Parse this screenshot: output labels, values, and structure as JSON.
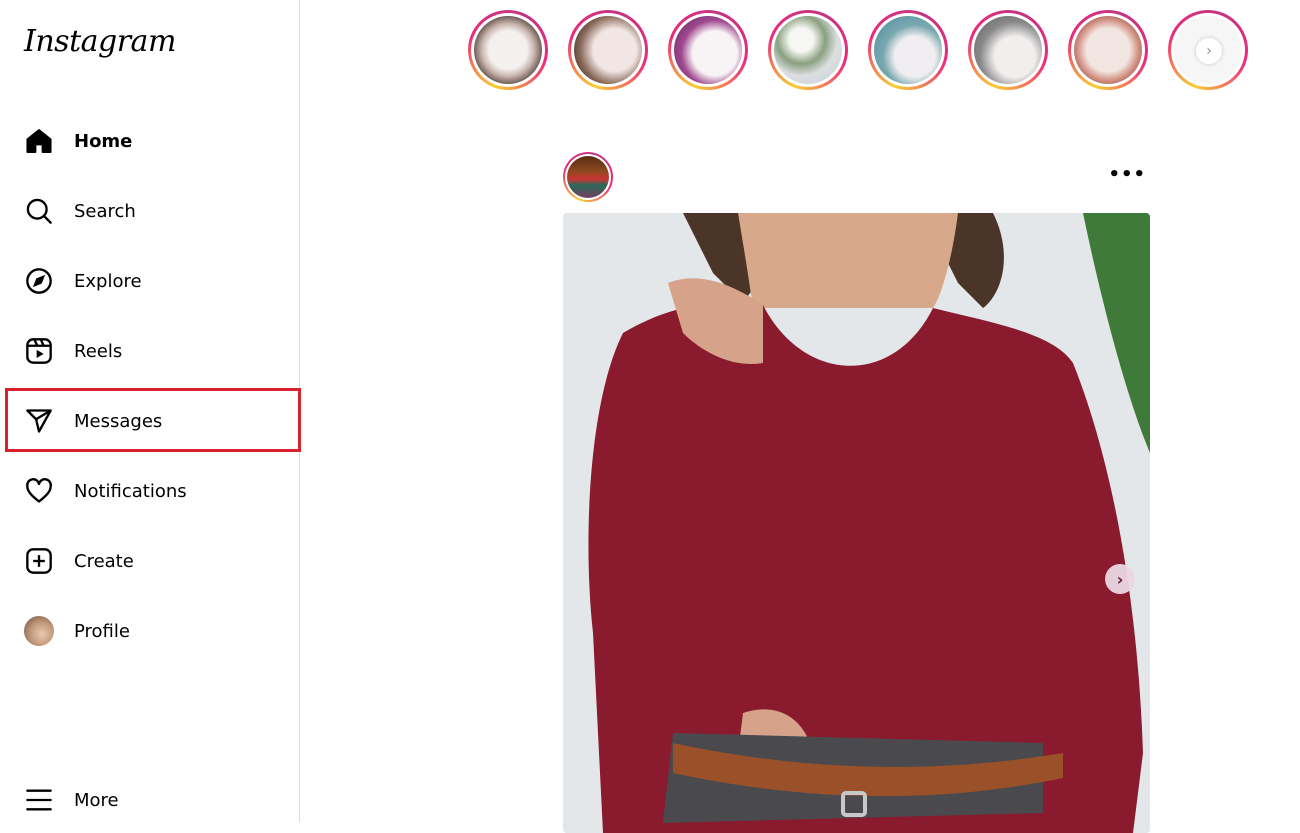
{
  "app": {
    "logo_text": "Instagram"
  },
  "sidebar": {
    "items": [
      {
        "label": "Home",
        "icon": "home-icon",
        "active": true
      },
      {
        "label": "Search",
        "icon": "search-icon"
      },
      {
        "label": "Explore",
        "icon": "compass-icon"
      },
      {
        "label": "Reels",
        "icon": "reels-icon"
      },
      {
        "label": "Messages",
        "icon": "paper-plane-icon",
        "highlighted": true
      },
      {
        "label": "Notifications",
        "icon": "heart-icon"
      },
      {
        "label": "Create",
        "icon": "plus-square-icon"
      },
      {
        "label": "Profile",
        "icon": "avatar"
      }
    ],
    "more": {
      "label": "More",
      "icon": "hamburger-icon"
    }
  },
  "stories": {
    "items": [
      {
        "name": ""
      },
      {
        "name": ""
      },
      {
        "name": ""
      },
      {
        "name": ""
      },
      {
        "name": ""
      },
      {
        "name": ""
      },
      {
        "name": ""
      },
      {
        "name": ""
      }
    ],
    "next_icon": "chevron-right-icon"
  },
  "post": {
    "username": "",
    "subtitle": "",
    "more_label": "•••",
    "carousel_next": "›"
  },
  "colors": {
    "highlight_border": "#d9222e",
    "story_ring_start": "#f9ce34",
    "story_ring_mid": "#ee2a7b",
    "story_ring_end": "#c13584",
    "sweater": "#8a1a2e"
  }
}
